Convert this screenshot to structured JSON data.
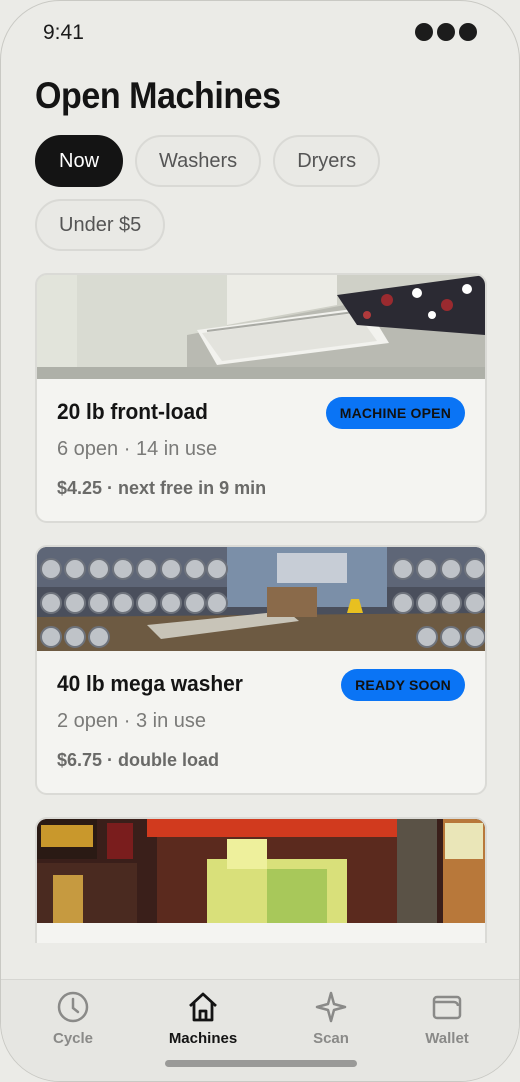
{
  "status_bar": {
    "time": "9:41"
  },
  "page_title": "Open Machines",
  "filters": [
    {
      "label": "Now",
      "active": true
    },
    {
      "label": "Washers",
      "active": false
    },
    {
      "label": "Dryers",
      "active": false
    },
    {
      "label": "Under $5",
      "active": false
    }
  ],
  "cards": [
    {
      "name": "20 lb front-load",
      "badge": "MACHINE OPEN",
      "stats": "6 open · 14 in use",
      "price": "$4.25 · next free in 9 min"
    },
    {
      "name": "40 lb mega washer",
      "badge": "READY SOON",
      "stats": "2 open · 3 in use",
      "price": "$6.75 · double load"
    },
    {
      "name": "",
      "badge": "",
      "stats": "",
      "price": ""
    }
  ],
  "tab_bar": {
    "items": [
      {
        "label": "Cycle",
        "icon": "clock-icon",
        "active": false
      },
      {
        "label": "Machines",
        "icon": "home-icon",
        "active": true
      },
      {
        "label": "Scan",
        "icon": "sparkle-icon",
        "active": false
      },
      {
        "label": "Wallet",
        "icon": "wallet-icon",
        "active": false
      }
    ]
  },
  "colors": {
    "accent": "#0a74f5",
    "active_chip": "#141414",
    "background": "#ebebe7"
  }
}
